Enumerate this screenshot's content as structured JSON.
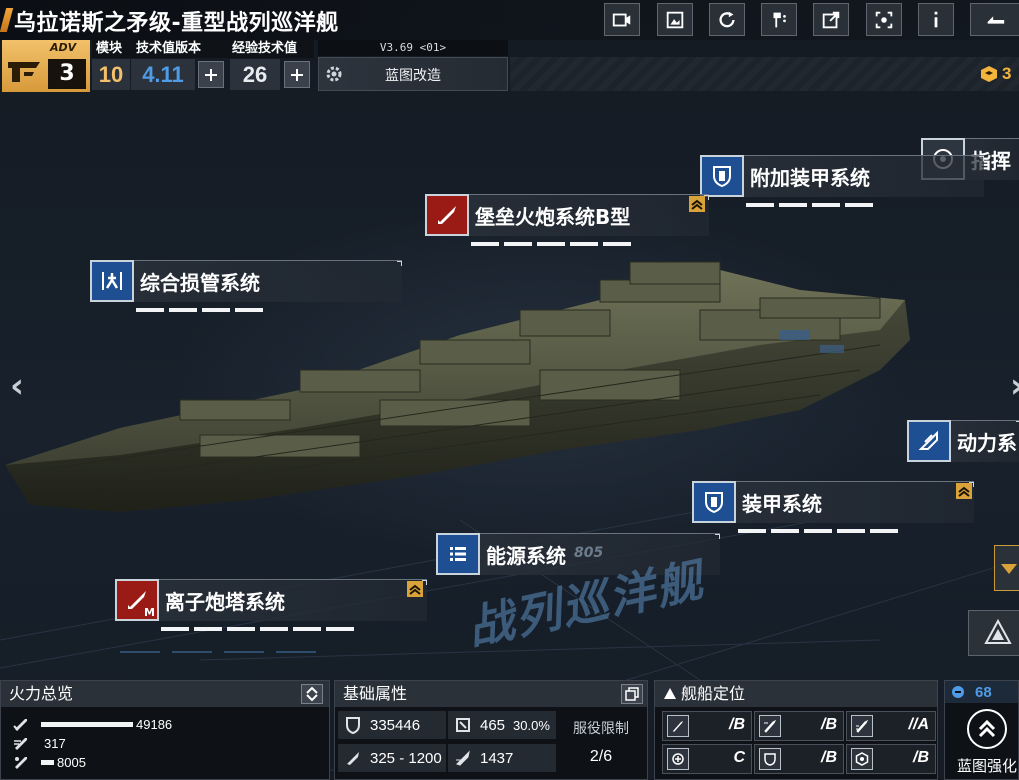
{
  "header": {
    "title": "乌拉诺斯之矛级-重型战列巡洋舰",
    "toolbar": [
      {
        "name": "video-icon"
      },
      {
        "name": "gallery-icon"
      },
      {
        "name": "refresh-icon"
      },
      {
        "name": "paint-icon"
      },
      {
        "name": "share-icon"
      },
      {
        "name": "view-icon"
      },
      {
        "name": "info-icon"
      },
      {
        "name": "exit-icon"
      }
    ]
  },
  "info": {
    "adv_label": "ADV",
    "adv_level": "3",
    "module_label": "模块",
    "module_value": "10",
    "tech_version_label": "技术值版本",
    "tech_version_value": "4.11",
    "exp_label": "经验技术值",
    "exp_value": "26",
    "version": "V3.69 <01>",
    "blueprint_mod": "蓝图改造",
    "currency_value": "3"
  },
  "systems": {
    "command": "指挥",
    "extra_armor": "附加装甲系统",
    "fortress_gun": "堡垒火炮系统B型",
    "damage_control": "综合损管系统",
    "power": "动力系",
    "armor": "装甲系统",
    "energy": "能源系统",
    "ion_turret": "离子炮塔系统",
    "ion_turret_tag": "M"
  },
  "watermark": {
    "text": "战列巡洋舰",
    "code": "805"
  },
  "firepower": {
    "title": "火力总览",
    "rows": [
      {
        "value": "49186",
        "fraction": 1.0
      },
      {
        "value": "317",
        "fraction": 0.0
      },
      {
        "value": "8005",
        "fraction": 0.14
      }
    ]
  },
  "attributes": {
    "title": "基础属性",
    "hp": "335446",
    "armor": "465",
    "armor_pct": "30.0%",
    "speed": "325 - 1200",
    "shield": "1437",
    "service_label": "服役限制",
    "service_value": "2/6"
  },
  "positioning": {
    "title": "舰船定位",
    "cells": [
      {
        "grade": "/B"
      },
      {
        "grade": "/B"
      },
      {
        "grade": "//A"
      },
      {
        "grade": "C"
      },
      {
        "grade": "/B"
      },
      {
        "grade": "/B"
      }
    ]
  },
  "enhance": {
    "count": "68",
    "label": "蓝图强化"
  },
  "colors": {
    "accent": "#f0a53a",
    "blue_icon": "#1f4f93",
    "red_icon": "#9a1a16",
    "tech_blue": "#4f9be6"
  }
}
